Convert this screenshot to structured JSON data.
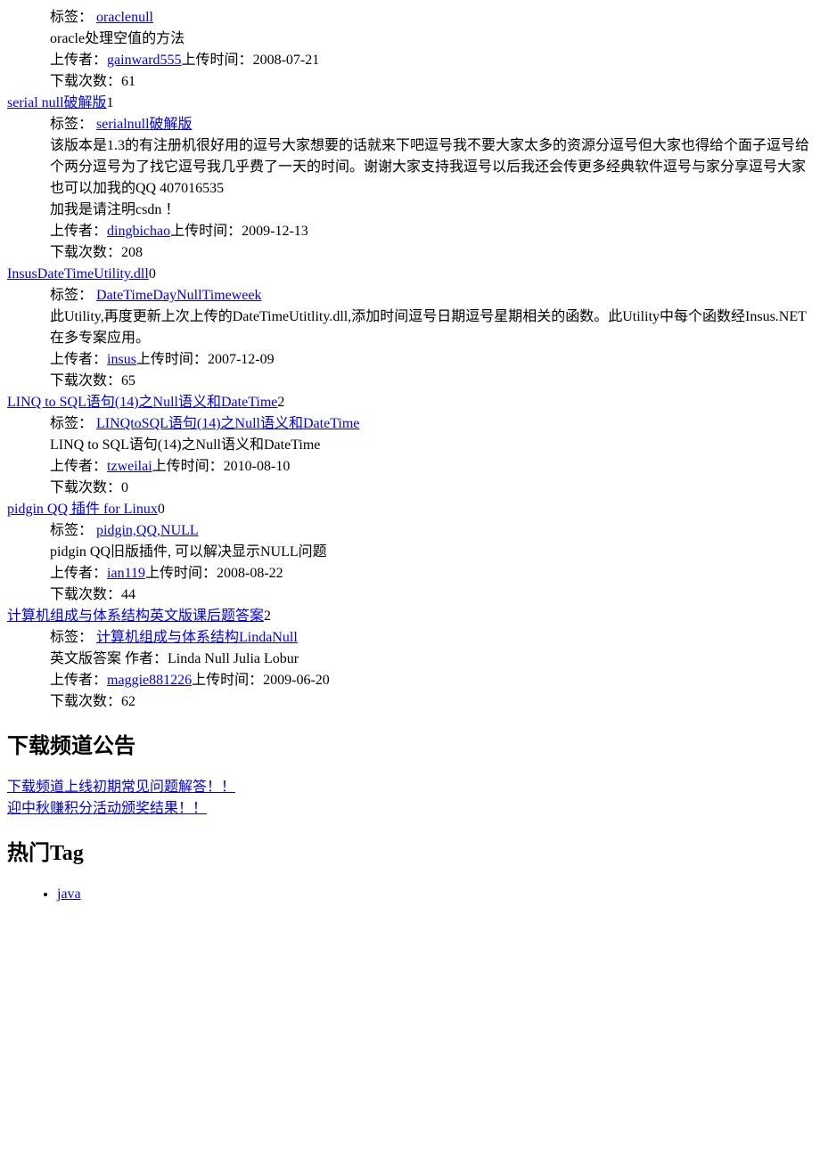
{
  "labels": {
    "tag": "标签：",
    "uploader": "上传者：",
    "uploadTime": "上传时间：",
    "downloads": "下载次数："
  },
  "items": [
    {
      "tags": "oraclenull",
      "desc": "oracle处理空值的方法",
      "uploader": "gainward555",
      "uploadTime": "2008-07-21",
      "downloads": "61"
    },
    {
      "title": "serial null破解版",
      "titleSuffix": "1",
      "tags": "serialnull破解版",
      "desc": "该版本是1.3的有注册机很好用的逗号大家想要的话就来下吧逗号我不要大家太多的资源分逗号但大家也得给个面子逗号给个两分逗号为了找它逗号我几乎费了一天的时间。谢谢大家支持我逗号以后我还会传更多经典软件逗号与家分享逗号大家也可以加我的QQ 407016535",
      "desc2": "加我是请注明csdn ！",
      "uploader": "dingbichao",
      "uploadTime": "2009-12-13",
      "downloads": "208"
    },
    {
      "title": "InsusDateTimeUtility.dll",
      "titleSuffix": "0",
      "tags": "DateTimeDayNullTimeweek",
      "desc": "此Utility,再度更新上次上传的DateTimeUtitlity.dll,添加时间逗号日期逗号星期相关的函数。此Utility中每个函数经Insus.NET在多专案应用。",
      "uploader": "insus",
      "uploadTime": "2007-12-09",
      "downloads": "65"
    },
    {
      "title": "LINQ to SQL语句(14)之Null语义和DateTime",
      "titleSuffix": "2",
      "tags": "LINQtoSQL语句(14)之Null语义和DateTime",
      "desc": "LINQ to SQL语句(14)之Null语义和DateTime",
      "uploader": "tzweilai",
      "uploadTime": "2010-08-10",
      "downloads": "0"
    },
    {
      "title": "pidgin QQ 插件 for Linux",
      "titleSuffix": "0",
      "tags": "pidgin,QQ,NULL",
      "desc": "pidgin QQ旧版插件, 可以解决显示NULL问题",
      "uploader": "ian119",
      "uploadTime": "2008-08-22",
      "downloads": "44"
    },
    {
      "title": "计算机组成与体系结构英文版课后题答案",
      "titleSuffix": "2",
      "tags": "计算机组成与体系结构LindaNull",
      "desc": "英文版答案 作者：Linda Null Julia Lobur",
      "uploader": "maggie881226",
      "uploadTime": "2009-06-20",
      "downloads": "62"
    }
  ],
  "sections": {
    "announcement": {
      "heading": "下载频道公告",
      "links": [
        "下载频道上线初期常见问题解答！！",
        "迎中秋赚积分活动颁奖结果！！"
      ]
    },
    "hotTag": {
      "heading": "热门Tag",
      "tags": [
        "java"
      ]
    }
  }
}
